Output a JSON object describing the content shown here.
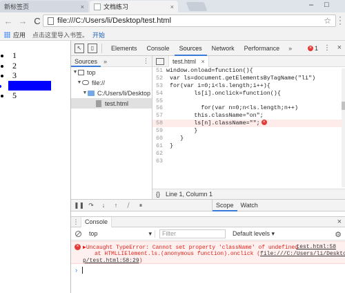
{
  "browser": {
    "tabs": [
      {
        "label": "新标签页",
        "close": "×"
      },
      {
        "label": "文档练习",
        "close": "×"
      }
    ],
    "window_controls": [
      "–",
      "□"
    ],
    "nav": {
      "back": "←",
      "forward": "→",
      "reload": "C"
    },
    "address": "file:///C:/Users/li/Desktop/test.html",
    "star": "☆",
    "bookmarks": {
      "apps": "应用",
      "hint": "点击这里导入书签。",
      "link": "开始"
    }
  },
  "page": {
    "list_items": [
      "1",
      "2",
      "3",
      "4",
      "5"
    ],
    "highlight_index": 3,
    "highlight_color": "#0000ff"
  },
  "devtools": {
    "tabs": [
      "Elements",
      "Console",
      "Sources",
      "Network",
      "Performance"
    ],
    "active_tab": "Sources",
    "more": "»",
    "error_count": "1",
    "close": "×",
    "navigator": {
      "tab": "Sources",
      "more": "»",
      "tree": [
        {
          "label": "top",
          "indent": 0
        },
        {
          "label": "file://",
          "indent": 1
        },
        {
          "label": "C:/Users/li/Desktop",
          "indent": 2
        },
        {
          "label": "test.html",
          "indent": 3
        }
      ]
    },
    "editor": {
      "file_tab": "test.html",
      "lines": [
        {
          "n": "51",
          "t": "window.onload=function(){"
        },
        {
          "n": "52",
          "t": " var ls=document.getElementsByTagName(\"li\")"
        },
        {
          "n": "53",
          "t": " for(var i=0;i<ls.length;i++){"
        },
        {
          "n": "54",
          "t": "        ls[i].onclick=function(){"
        },
        {
          "n": "55",
          "t": ""
        },
        {
          "n": "56",
          "t": "          for(var n=0;n<ls.length;n++)"
        },
        {
          "n": "57",
          "t": "        this.className=\"on\";"
        },
        {
          "n": "58",
          "t": "        ls[n].className=\"\";",
          "error": true
        },
        {
          "n": "59",
          "t": "        }"
        },
        {
          "n": "60",
          "t": "    }"
        },
        {
          "n": "61",
          "t": " }"
        },
        {
          "n": "62",
          "t": ""
        },
        {
          "n": "63",
          "t": ""
        }
      ],
      "status": "Line 1, Column 1",
      "format_icon": "{}"
    },
    "debugger": {
      "scope_tabs": [
        "Scope",
        "Watch"
      ]
    },
    "console": {
      "drawer_tab": "Console",
      "context": "top",
      "filter_placeholder": "Filter",
      "levels": "Default levels ▾",
      "error": {
        "line1": "▶Uncaught TypeError: Cannot set property 'className' of undefined",
        "source": "test.html:58",
        "line2_prefix": "at HTMLLIElement.ls.(anonymous function).onclick (",
        "line2_link": "file:///C:/Users/li/Deskto",
        "line3": "p/test.html:58:29",
        "line3_suffix": ")"
      },
      "prompt": "›"
    }
  }
}
